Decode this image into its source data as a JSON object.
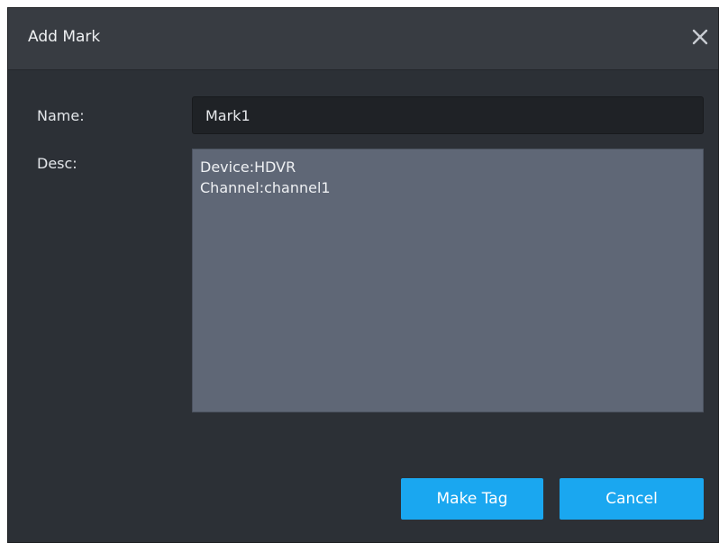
{
  "dialog": {
    "title": "Add Mark",
    "close_icon": "close-icon"
  },
  "form": {
    "name_label": "Name:",
    "name_value": "Mark1",
    "desc_label": "Desc:",
    "desc_value": "Device:HDVR\nChannel:channel1"
  },
  "buttons": {
    "make_tag": "Make Tag",
    "cancel": "Cancel"
  },
  "colors": {
    "accent": "#1aa7f0",
    "dialog_bg": "#2c3036",
    "title_bg": "#383c42",
    "desc_bg": "#5f6776"
  }
}
